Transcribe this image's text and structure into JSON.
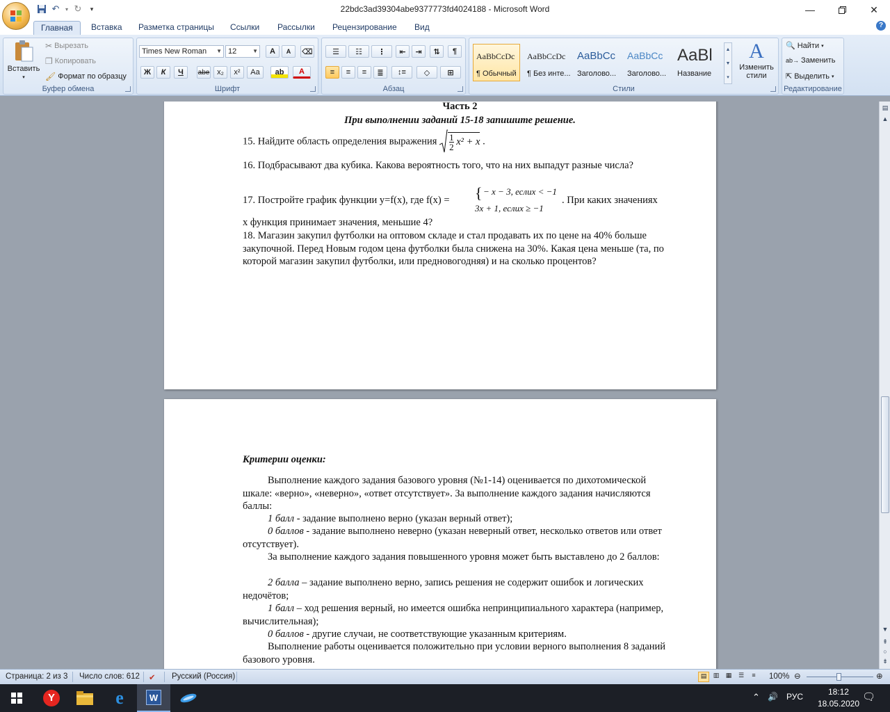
{
  "window": {
    "title": "22bdc3ad39304abe9377773fd4024188 - Microsoft Word"
  },
  "tabs": [
    "Главная",
    "Вставка",
    "Разметка страницы",
    "Ссылки",
    "Рассылки",
    "Рецензирование",
    "Вид"
  ],
  "ribbon": {
    "clipboard": {
      "label": "Буфер обмена",
      "paste": "Вставить",
      "cut": "Вырезать",
      "copy": "Копировать",
      "format_painter": "Формат по образцу"
    },
    "font": {
      "label": "Шрифт",
      "font_name": "Times New Roman",
      "font_size": "12",
      "bold": "Ж",
      "italic": "К",
      "underline": "Ч",
      "strike": "abe",
      "subscript": "x₂",
      "superscript": "x²",
      "change_case": "Aa",
      "grow": "A",
      "shrink": "A"
    },
    "paragraph": {
      "label": "Абзац"
    },
    "styles": {
      "label": "Стили",
      "items": [
        {
          "sample": "AaBbCcDc",
          "name": "¶ Обычный"
        },
        {
          "sample": "AaBbCcDc",
          "name": "¶ Без инте..."
        },
        {
          "sample": "AaBbCc",
          "name": "Заголово..."
        },
        {
          "sample": "AaBbCc",
          "name": "Заголово..."
        },
        {
          "sample": "AaBl",
          "name": "Название"
        }
      ],
      "change_styles": "Изменить стили"
    },
    "editing": {
      "label": "Редактирование",
      "find": "Найти",
      "replace": "Заменить",
      "select": "Выделить"
    }
  },
  "document": {
    "page1": {
      "part_title": "Часть 2",
      "instruction": "При выполнении заданий 15-18 запишите решение.",
      "q15_text": "15. Найдите область  определения выражения",
      "q15_num": "1",
      "q15_den": "2",
      "q15_rest": "x² + x",
      "q15_end": ".",
      "q16": "16. Подбрасывают два кубика. Какова вероятность того, что  на них выпадут разные числа?",
      "q17_a": "17. Постройте график функции y=f(x), где f(x) =",
      "q17_case1": "− x − 3, еслих < −1",
      "q17_case2": "3x + 1, еслих ≥ −1",
      "q17_b": ". При каких значениях",
      "q17_c": "х функция принимает значения, меньшие 4?",
      "q18": "18. Магазин закупил футболки на оптовом складе и стал продавать их по цене на 40% больше закупочной. Перед Новым годом цена футболки была снижена на 30%. Какая цена меньше (та, по которой магазин закупил футболки, или предновогодняя) и на сколько процентов?"
    },
    "page2": {
      "criteria_title": "Критерии оценки:",
      "p1": "Выполнение каждого задания базового уровня (№1-14)  оценивается по дихотомической шкале: «верно», «неверно», «ответ отсутствует». За  выполнение каждого задания начисляются баллы:",
      "b1_em": "1 балл",
      "b1": "  - задание выполнено верно (указан верный ответ);",
      "b0_em": "0 баллов",
      "b0": "  - задание выполнено неверно (указан неверный ответ, несколько ответов или ответ отсутствует).",
      "p2": "За выполнение каждого задания повышенного уровня может быть выставлено до 2 баллов:",
      "c2_em": "2 балла",
      "c2": " – задание выполнено верно, запись решения не содержит ошибок и логических недочётов;",
      "c1_em": "1 балл",
      "c1": " – ход решения верный, но имеется ошибка непринципиального характера (например, вычислительная);",
      "c0_em": "0 баллов",
      "c0": "  - другие случаи, не соответствующие указанным критериям.",
      "p3": "Выполнение работы оценивается положительно при условии верного выполнения 8 заданий базового уровня."
    }
  },
  "statusbar": {
    "page": "Страница: 2 из 3",
    "words": "Число слов: 612",
    "language": "Русский (Россия)",
    "zoom": "100%"
  },
  "taskbar": {
    "lang": "РУС",
    "time": "18:12",
    "date": "18.05.2020"
  }
}
